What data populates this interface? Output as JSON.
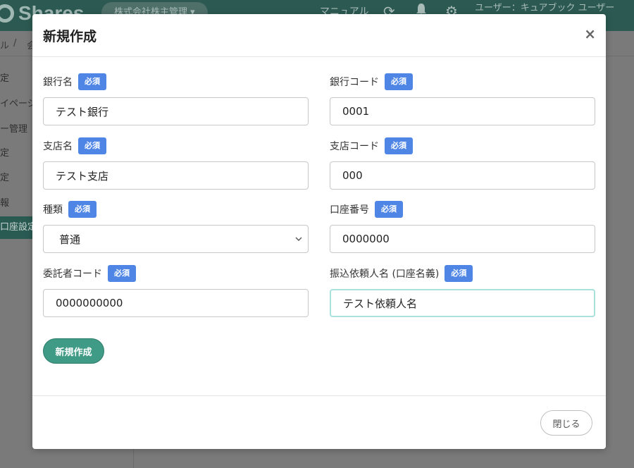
{
  "app": {
    "logo_text": "Shares",
    "company_selector": "株式会社株主管理 ▾",
    "manual_link": "マニュアル",
    "user_label": "ユーザー：キュアブック ユーザー",
    "breadcrumb": [
      "ル",
      "/",
      "会"
    ],
    "sidebar_items": [
      "定",
      "イページ",
      "ー管理",
      "定",
      "定",
      "報",
      "口座設定"
    ]
  },
  "modal": {
    "title": "新規作成",
    "close_symbol": "×",
    "required_badge": "必須",
    "fields": {
      "bank_name": {
        "label": "銀行名",
        "value": "テスト銀行"
      },
      "bank_code": {
        "label": "銀行コード",
        "value": "0001"
      },
      "branch_name": {
        "label": "支店名",
        "value": "テスト支店"
      },
      "branch_code": {
        "label": "支店コード",
        "value": "000"
      },
      "account_type": {
        "label": "種類",
        "value": "普通"
      },
      "account_number": {
        "label": "口座番号",
        "value": "0000000"
      },
      "consignor_code": {
        "label": "委託者コード",
        "value": "0000000000"
      },
      "transfer_requester": {
        "label": "振込依頼人名 (口座名義)",
        "value": "テスト依頼人名"
      }
    },
    "create_button": "新規作成",
    "footer_close_button": "閉じる"
  },
  "colors": {
    "topbar": "#2c5a52",
    "required_badge": "#4f86e6",
    "create_button": "#3f9b86",
    "focus_border": "#a9e2dc"
  },
  "icons": [
    "refresh-icon",
    "bell-icon",
    "gear-icon",
    "close-icon",
    "chevron-down-icon"
  ]
}
